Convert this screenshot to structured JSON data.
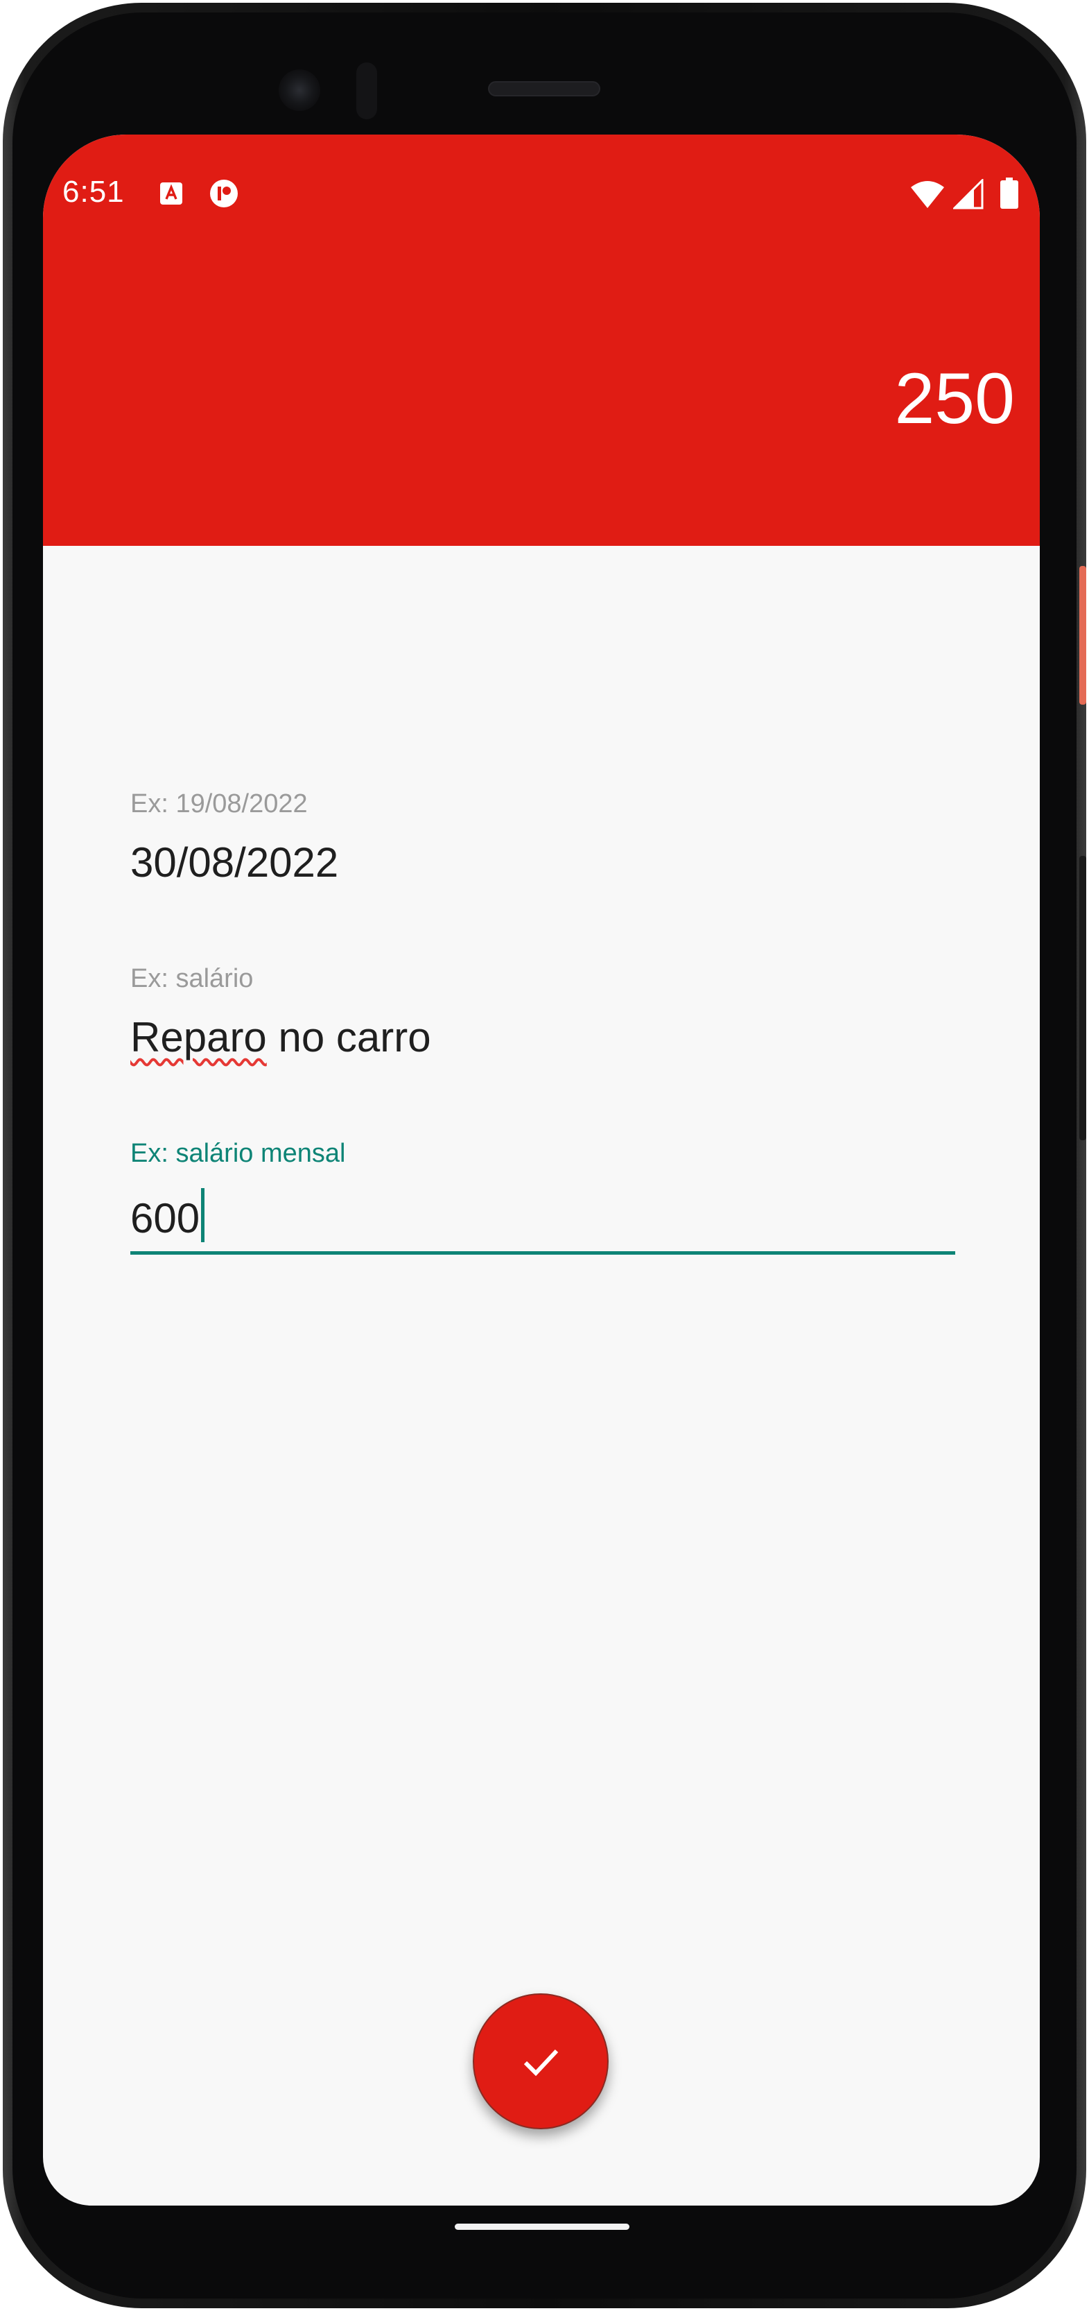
{
  "status_bar": {
    "time": "6:51",
    "icons": [
      "app-a-notification-icon",
      "app-r-notification-icon",
      "wifi-icon",
      "signal-icon",
      "battery-icon"
    ]
  },
  "app_bar": {
    "value": "250",
    "color": "#e01c14"
  },
  "form": {
    "date_field": {
      "label": "Ex: 19/08/2022",
      "value": "30/08/2022"
    },
    "description_field": {
      "label": "Ex: salário",
      "value_word1": "Reparo",
      "value_rest": " no carro"
    },
    "amount_field": {
      "label": "Ex: salário mensal",
      "value": "600",
      "focused": true,
      "accent_color": "#0e8476"
    }
  },
  "fab": {
    "icon": "check-icon"
  }
}
